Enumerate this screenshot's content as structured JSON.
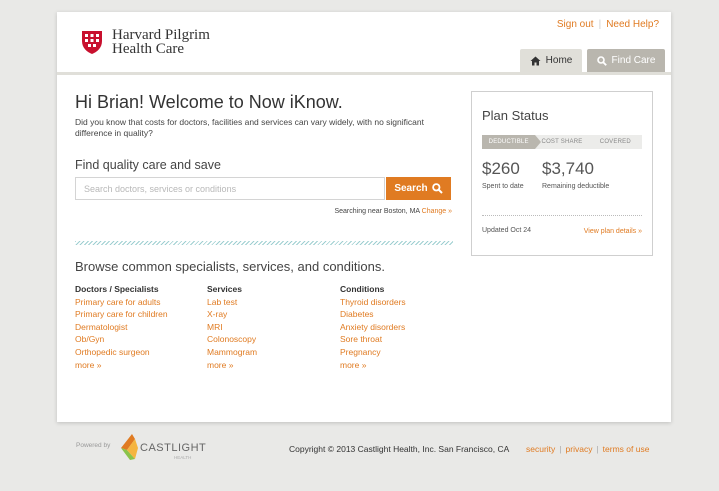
{
  "header": {
    "logo_line1": "Harvard Pilgrim",
    "logo_line2": "Health Care",
    "sign_out": "Sign out",
    "need_help": "Need Help?",
    "tabs": [
      {
        "label": "Home",
        "icon": "home-icon"
      },
      {
        "label": "Find Care",
        "icon": "search-icon"
      }
    ]
  },
  "main": {
    "welcome": "Hi Brian! Welcome to Now iKnow.",
    "intro": "Did you know that costs for doctors, facilities and services can vary widely, with no significant difference in quality?",
    "find_title": "Find quality care and save",
    "search_placeholder": "Search doctors, services or conditions",
    "search_button": "Search",
    "near_text": "Searching near Boston, MA",
    "change_link": "Change »",
    "browse_title": "Browse common specialists, services, and conditions.",
    "columns": [
      {
        "heading": "Doctors / Specialists",
        "items": [
          "Primary care for adults",
          "Primary care for children",
          "Dermatologist",
          "Ob/Gyn",
          "Orthopedic surgeon"
        ],
        "more": "more »"
      },
      {
        "heading": "Services",
        "items": [
          "Lab test",
          "X-ray",
          "MRI",
          "Colonoscopy",
          "Mammogram"
        ],
        "more": "more »"
      },
      {
        "heading": "Conditions",
        "items": [
          "Thyroid disorders",
          "Diabetes",
          "Anxiety disorders",
          "Sore throat",
          "Pregnancy"
        ],
        "more": "more »"
      }
    ]
  },
  "plan": {
    "title": "Plan Status",
    "steps": [
      "DEDUCTIBLE",
      "COST SHARE",
      "COVERED"
    ],
    "spent_amount": "$260",
    "spent_label": "Spent to date",
    "remaining_amount": "$3,740",
    "remaining_label": "Remaining deductible",
    "updated": "Updated Oct 24",
    "view_link": "View plan details »"
  },
  "footer": {
    "powered_by": "Powered by",
    "castlight": "CASTLIGHT",
    "castlight_sub": "HEALTH",
    "copyright": "Copyright © 2013 Castlight Health, Inc. San Francisco, CA",
    "links": [
      "security",
      "privacy",
      "terms of use"
    ]
  },
  "colors": {
    "accent": "#e07b22",
    "brand_red": "#c8102e",
    "tab_active": "#b9b6ae",
    "hatch": "#9ecfd1"
  }
}
